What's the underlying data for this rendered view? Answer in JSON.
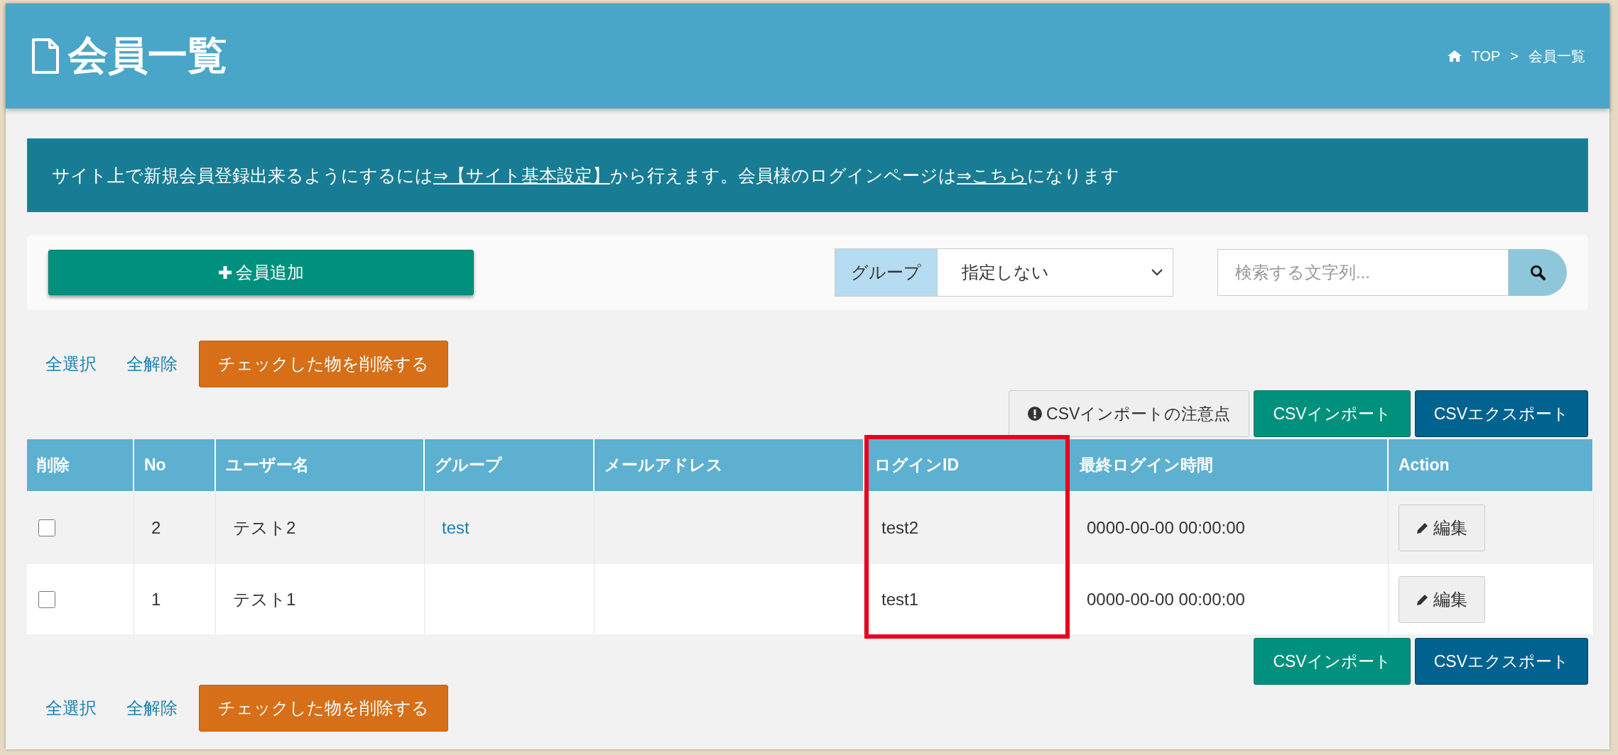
{
  "header": {
    "title": "会員一覧",
    "breadcrumb": [
      {
        "label": "TOP",
        "kind": "home"
      },
      {
        "label": "会員一覧",
        "kind": "current"
      }
    ],
    "separator": ">"
  },
  "notice": {
    "segments": [
      {
        "kind": "text",
        "text": "サイト上で新規会員登録出来るようにするには"
      },
      {
        "kind": "link",
        "text": "⇒【サイト基本設定】"
      },
      {
        "kind": "text",
        "text": "から行えます。会員様のログインページは"
      },
      {
        "kind": "link",
        "text": "⇒こちら"
      },
      {
        "kind": "text",
        "text": "になります"
      }
    ]
  },
  "toolbar": {
    "add_button": "会員追加",
    "group_filter": {
      "label": "グループ",
      "value": "指定しない"
    },
    "search": {
      "placeholder": "検索する文字列..."
    }
  },
  "bulk_actions_top": [
    {
      "kind": "link",
      "label": "全選択"
    },
    {
      "kind": "link",
      "label": "全解除"
    },
    {
      "kind": "danger",
      "label": "チェックした物を削除する"
    }
  ],
  "csv_actions_top": [
    {
      "kind": "notice",
      "label": "CSVインポートの注意点"
    },
    {
      "kind": "import",
      "label": "CSVインポート"
    },
    {
      "kind": "export",
      "label": "CSVエクスポート"
    }
  ],
  "table": {
    "columns": [
      {
        "label": "削除",
        "highlighted": false
      },
      {
        "label": "No",
        "highlighted": false
      },
      {
        "label": "ユーザー名",
        "highlighted": false
      },
      {
        "label": "グループ",
        "highlighted": false
      },
      {
        "label": "メールアドレス",
        "highlighted": false
      },
      {
        "label": "ログインID",
        "highlighted": true
      },
      {
        "label": "最終ログイン時間",
        "highlighted": false
      },
      {
        "label": "Action",
        "highlighted": false
      }
    ],
    "rows": [
      {
        "checked": false,
        "no": "2",
        "username": "テスト2",
        "group": "test",
        "login_id": "test2",
        "last_login": "0000-00-00 00:00:00",
        "action": "編集"
      },
      {
        "checked": false,
        "no": "1",
        "username": "テスト1",
        "login_id": "test1",
        "last_login": "0000-00-00 00:00:00",
        "action": "編集"
      }
    ]
  },
  "csv_actions_bottom": [
    {
      "kind": "import",
      "label": "CSVインポート"
    },
    {
      "kind": "export",
      "label": "CSVエクスポート"
    }
  ],
  "bulk_actions_bottom": [
    {
      "kind": "link",
      "label": "全選択"
    },
    {
      "kind": "link",
      "label": "全解除"
    },
    {
      "kind": "danger",
      "label": "チェックした物を削除する"
    }
  ]
}
